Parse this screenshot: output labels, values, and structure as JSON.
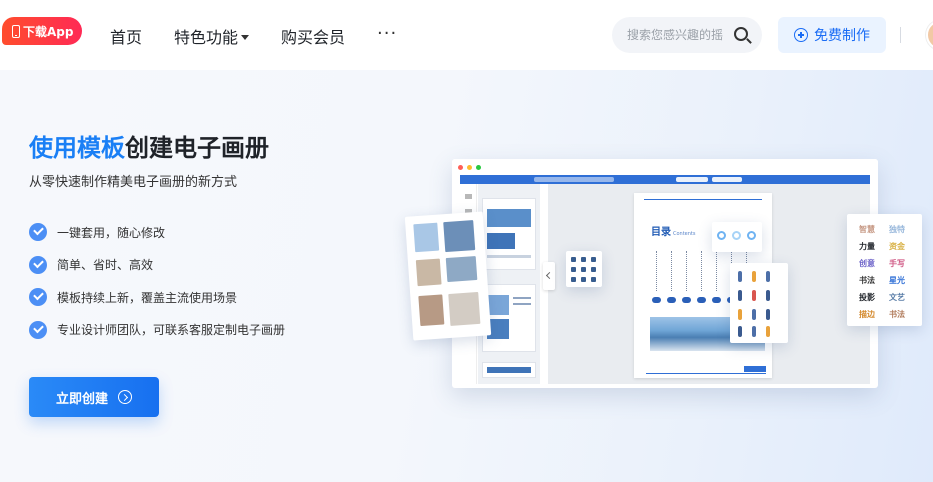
{
  "header": {
    "app_badge": "下载App",
    "nav": [
      {
        "label": "首页",
        "has_dropdown": false
      },
      {
        "label": "特色功能",
        "has_dropdown": true
      },
      {
        "label": "购买会员",
        "has_dropdown": false
      }
    ],
    "more": "···",
    "search_placeholder": "搜索您感兴趣的摇",
    "create_free_label": "免费制作"
  },
  "hero": {
    "title_highlight": "使用模板",
    "title_rest": "创建电子画册",
    "subtitle": "从零快速制作精美电子画册的新方式",
    "features": [
      "一键套用，随心修改",
      "简单、省时、高效",
      "模板持续上新，覆盖主流使用场景",
      "专业设计师团队，可联系客服定制电子画册"
    ],
    "cta_label": "立即创建"
  },
  "preview": {
    "page_title": "目录",
    "page_subtitle": "Contents",
    "text_samples": [
      "智慧",
      "独特",
      "力量",
      "资金",
      "创意",
      "手写",
      "书法",
      "星光",
      "投影",
      "文艺",
      "描边",
      "书法"
    ]
  },
  "colors": {
    "accent": "#1a7ff5",
    "cta": "#1770f0",
    "badge": "#ff3a45",
    "check": "#4c8ff5"
  }
}
